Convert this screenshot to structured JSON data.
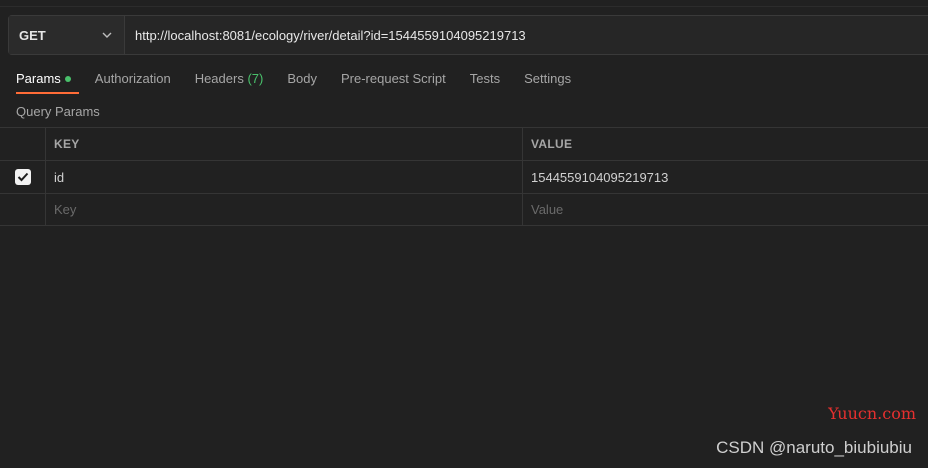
{
  "request": {
    "method": "GET",
    "url": "http://localhost:8081/ecology/river/detail?id=1544559104095219713"
  },
  "tabs": {
    "params": "Params",
    "authorization": "Authorization",
    "headers": "Headers",
    "headers_count": "(7)",
    "body": "Body",
    "prerequest": "Pre-request Script",
    "tests": "Tests",
    "settings": "Settings"
  },
  "query_params": {
    "title": "Query Params",
    "columns": {
      "key": "KEY",
      "value": "VALUE"
    },
    "rows": [
      {
        "enabled": true,
        "key": "id",
        "value": "1544559104095219713"
      }
    ],
    "new_row": {
      "key_placeholder": "Key",
      "value_placeholder": "Value"
    }
  },
  "watermarks": {
    "site": "Yuucn.com",
    "author": "CSDN @naruto_biubiubiu"
  },
  "colors": {
    "accent": "#ff6c37",
    "status_green": "#49c06b",
    "watermark_red": "#e5302f"
  }
}
